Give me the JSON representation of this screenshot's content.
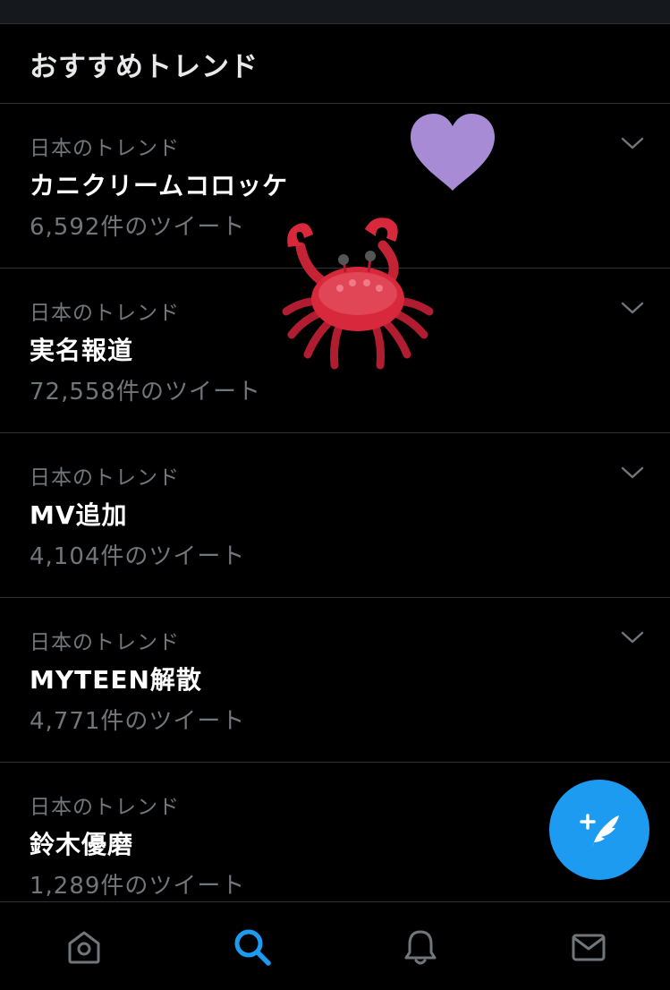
{
  "section": {
    "title": "おすすめトレンド"
  },
  "trends": [
    {
      "context": "日本のトレンド",
      "name": "カニクリームコロッケ",
      "count": "6,592件のツイート"
    },
    {
      "context": "日本のトレンド",
      "name": "実名報道",
      "count": "72,558件のツイート"
    },
    {
      "context": "日本のトレンド",
      "name": "MV追加",
      "count": "4,104件のツイート"
    },
    {
      "context": "日本のトレンド",
      "name": "MYTEEN解散",
      "count": "4,771件のツイート"
    },
    {
      "context": "日本のトレンド",
      "name": "鈴木優磨",
      "count": "1,289件のツイート"
    }
  ],
  "icons": {
    "chevron": "chevron-down-icon",
    "heart_sticker": "heart-sticker-icon",
    "crab_sticker": "crab-sticker-icon",
    "compose": "compose-tweet-icon",
    "home": "home-icon",
    "search": "search-icon",
    "notifications": "bell-icon",
    "messages": "mail-icon"
  },
  "colors": {
    "background": "#000000",
    "accent": "#1d9bf0",
    "secondary_text": "#71767b",
    "divider": "#2f3336",
    "heart": "#a78bd4",
    "crab": "#d8283c"
  },
  "bottom_nav": {
    "active": "search"
  }
}
